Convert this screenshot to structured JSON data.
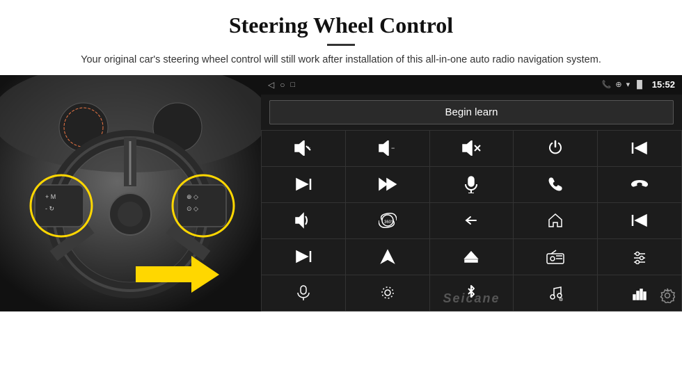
{
  "header": {
    "title": "Steering Wheel Control",
    "subtitle": "Your original car's steering wheel control will still work after installation of this all-in-one auto radio navigation system."
  },
  "android_ui": {
    "status_bar": {
      "back_icon": "◁",
      "home_icon": "○",
      "recent_icon": "□",
      "signal_icon": "▐▌",
      "time": "15:52",
      "phone_icon": "📞",
      "location_icon": "⊕",
      "wifi_icon": "▾"
    },
    "begin_learn_label": "Begin learn",
    "watermark": "Seicane",
    "icons": [
      {
        "id": "vol-up",
        "symbol": "🔊+"
      },
      {
        "id": "vol-down",
        "symbol": "🔉−"
      },
      {
        "id": "mute",
        "symbol": "🔇"
      },
      {
        "id": "power",
        "symbol": "⏻"
      },
      {
        "id": "prev-track",
        "symbol": "⏮"
      },
      {
        "id": "skip-next",
        "symbol": "⏭"
      },
      {
        "id": "fast-forward",
        "symbol": "⏩"
      },
      {
        "id": "mic",
        "symbol": "🎙"
      },
      {
        "id": "phone",
        "symbol": "📞"
      },
      {
        "id": "hang-up",
        "symbol": "↩"
      },
      {
        "id": "speaker",
        "symbol": "🔈"
      },
      {
        "id": "camera-360",
        "symbol": "⊙"
      },
      {
        "id": "back",
        "symbol": "↩"
      },
      {
        "id": "home",
        "symbol": "⌂"
      },
      {
        "id": "skip-back",
        "symbol": "⏮"
      },
      {
        "id": "fast-fwd2",
        "symbol": "⏭"
      },
      {
        "id": "navigate",
        "symbol": "▶"
      },
      {
        "id": "eject",
        "symbol": "⏏"
      },
      {
        "id": "radio",
        "symbol": "📻"
      },
      {
        "id": "eq",
        "symbol": "⚌"
      },
      {
        "id": "mic2",
        "symbol": "🎤"
      },
      {
        "id": "settings2",
        "symbol": "⊙"
      },
      {
        "id": "bluetooth",
        "symbol": "✦"
      },
      {
        "id": "music",
        "symbol": "♫"
      },
      {
        "id": "equalizer",
        "symbol": "|||"
      }
    ]
  }
}
